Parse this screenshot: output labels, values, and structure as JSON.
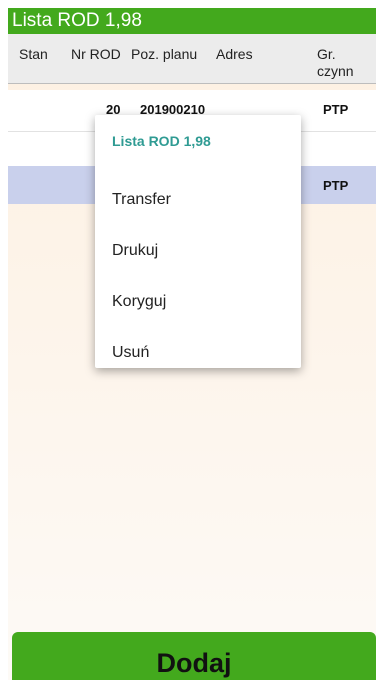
{
  "title": "Lista ROD 1,98",
  "columns": [
    "Stan",
    "Nr ROD",
    "Poz. planu",
    "Adres",
    "Gr. czynn"
  ],
  "rows": [
    {
      "stan": "",
      "nr_rod": "20",
      "poz_planu": "201900210",
      "adres": "",
      "gr_czynn": "PTP"
    },
    {
      "stan": "",
      "nr_rod": "",
      "poz_planu": "",
      "adres": "",
      "gr_czynn": ""
    },
    {
      "stan": "",
      "nr_rod": "",
      "poz_planu": "",
      "adres": "",
      "gr_czynn": "PTP"
    }
  ],
  "context_menu": {
    "title": "Lista ROD 1,98",
    "items": [
      "Transfer",
      "Drukuj",
      "Koryguj",
      "Usuń"
    ]
  },
  "add_button_label": "Dodaj",
  "colors": {
    "accent": "#43a91d",
    "menu_title": "#2f9b93",
    "selected_row": "#c9d0ec"
  }
}
